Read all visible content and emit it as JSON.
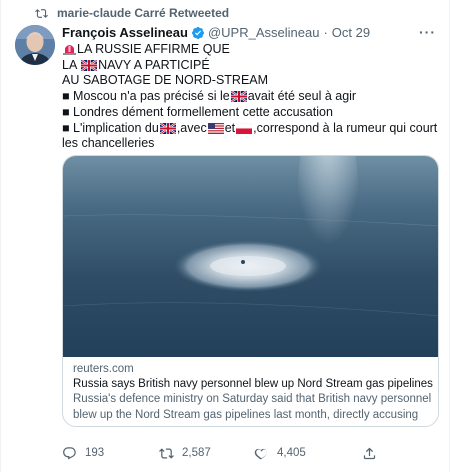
{
  "retweet": {
    "label": "marie-claude Carré Retweeted",
    "icon": "retweet-icon"
  },
  "tweet": {
    "author_name": "François Asselineau",
    "handle": "@UPR_Asselineau",
    "separator": "·",
    "date": "Oct 29",
    "more_icon": "more-icon",
    "lines": {
      "l1": "LA RUSSIE AFFIRME QUE",
      "l2": "NAVY A PARTICIPÉ",
      "l3": "AU SABOTAGE DE NORD-STREAM",
      "b1_pre": "Moscou n'a pas précisé si le",
      "b1_post": "avait été seul à agir",
      "b2": "Londres dément formellement cette accusation",
      "b3_pre": "L'implication du",
      "b3_mid1": ",avec",
      "b3_mid2": "et",
      "b3_post": ",correspond à la rumeur qui court les chancelleries",
      "bullet": "■"
    },
    "flags": [
      "red-siren-emoji",
      "uk-flag",
      "uk-flag",
      "uk-flag",
      "us-flag",
      "poland-flag"
    ]
  },
  "card": {
    "domain": "reuters.com",
    "title": "Russia says British navy personnel blew up Nord Stream gas pipelines",
    "description": "Russia's defence ministry on Saturday said that British navy personnel blew up the Nord Stream gas pipelines last month, directly accusing a..."
  },
  "actions": {
    "replies": "193",
    "retweets": "2,587",
    "likes": "4,405"
  },
  "colors": {
    "text": "#0f1419",
    "muted": "#536471",
    "verified": "#1d9bf0",
    "border": "#cfd9de",
    "sea": "#2c4b63"
  }
}
